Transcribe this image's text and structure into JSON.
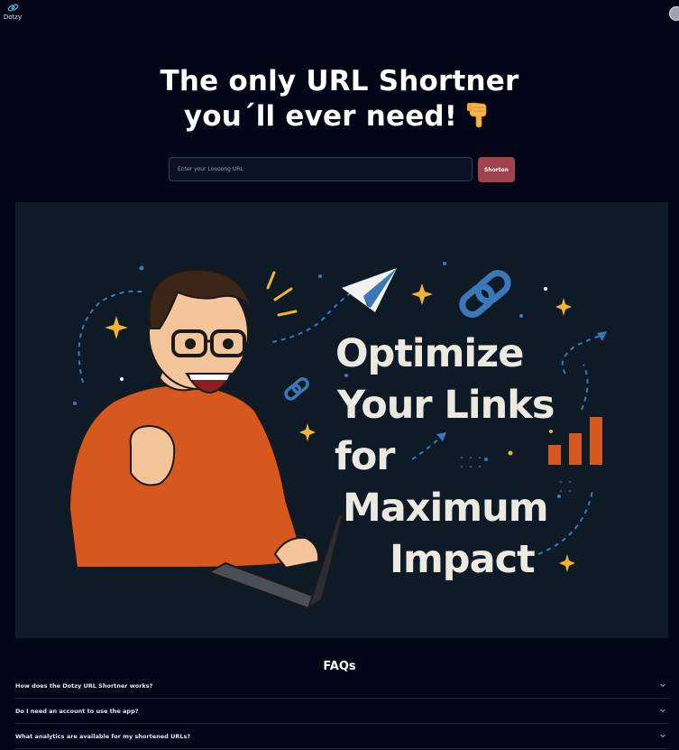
{
  "app": {
    "logo_text": "Dotzy"
  },
  "hero": {
    "title_line1": "The only URL Shortner",
    "title_line2": "you´ll ever need!",
    "emoji": "pointing-down-hand"
  },
  "form": {
    "input_placeholder": "Enter your Loooong URL",
    "input_value": "",
    "button_label": "Shorten"
  },
  "banner": {
    "line1": "Optimize",
    "line2": "Your Links",
    "line3": "for",
    "line4": "Maximum",
    "line5": "Impact"
  },
  "faq": {
    "title": "FAQs",
    "items": [
      {
        "question": "How does the Dotzy URL Shortner works?"
      },
      {
        "question": "Do I need an account to use the app?"
      },
      {
        "question": "What analytics are available for my shortened URLs?"
      }
    ]
  },
  "colors": {
    "background": "#020617",
    "button": "#a0424b",
    "banner_bg": "#0f1a27",
    "accent_blue": "#3b78b8",
    "accent_orange": "#d6581f",
    "accent_yellow": "#f2b531"
  }
}
